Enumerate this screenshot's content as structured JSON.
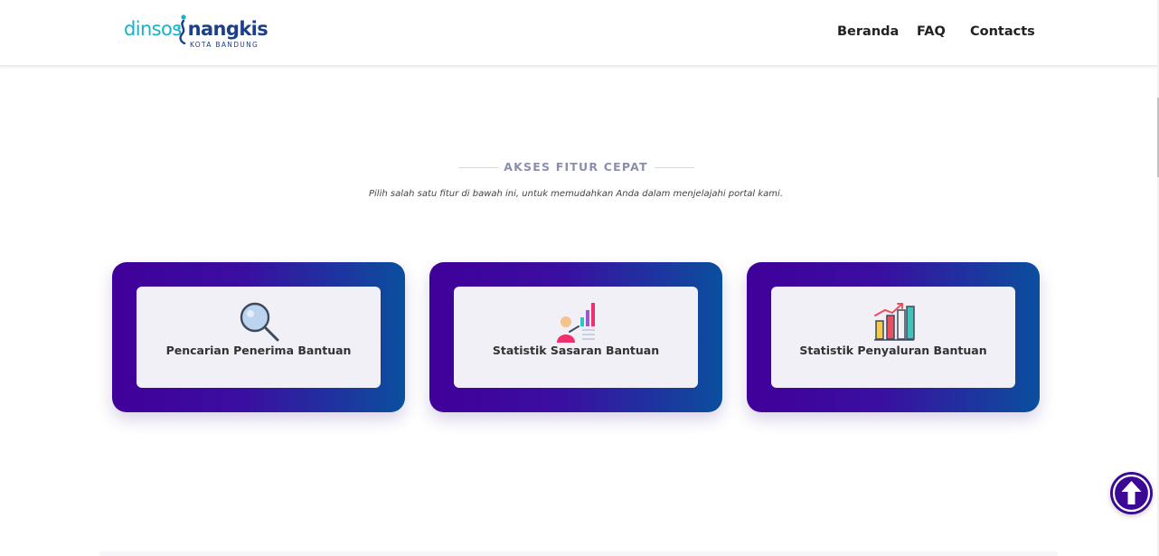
{
  "header": {
    "logo": {
      "dinsos": "dinsos",
      "nangkis": "nangkis",
      "sub": "KOTA BANDUNG"
    },
    "nav": [
      {
        "label": "Beranda"
      },
      {
        "label": "FAQ"
      },
      {
        "label": "Contacts"
      }
    ]
  },
  "section": {
    "title": "AKSES FITUR CEPAT",
    "subtitle": "Pilih salah satu fitur di bawah ini, untuk memudahkan Anda dalam menjelajahi portal kami."
  },
  "cards": [
    {
      "label": "Pencarian Penerima Bantuan",
      "icon": "magnifier-icon"
    },
    {
      "label": "Statistik Sasaran Bantuan",
      "icon": "statistics-person-icon"
    },
    {
      "label": "Statistik Penyaluran Bantuan",
      "icon": "bar-chart-growth-icon"
    }
  ],
  "scroll_top": {
    "icon": "arrow-up-icon"
  },
  "colors": {
    "brand_cyan": "#17b1c8",
    "brand_navy": "#1d3f8a",
    "card_gradient_start": "#40009a",
    "card_gradient_end": "#0a4f9e",
    "fab": "#3c0994"
  }
}
